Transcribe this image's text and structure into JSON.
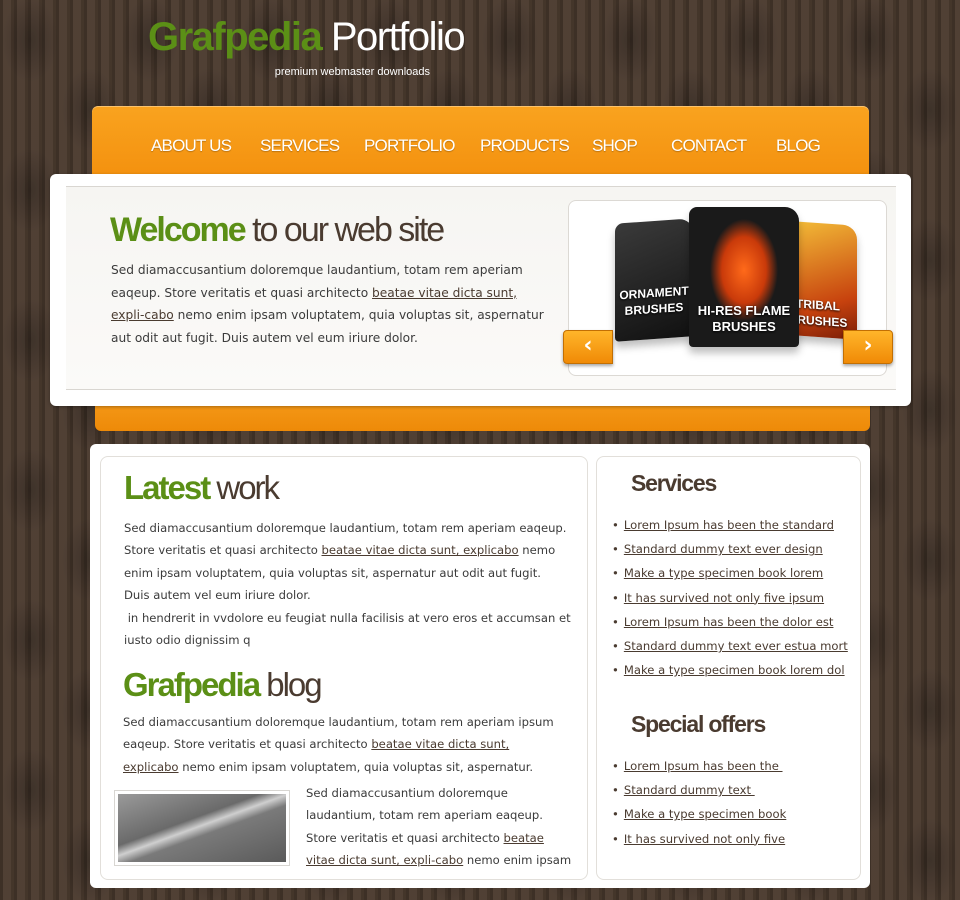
{
  "header": {
    "brand_green": "Grafpedia",
    "brand_white": "Portfolio",
    "tagline": "premium webmaster downloads"
  },
  "nav": {
    "items": [
      "ABOUT US",
      "SERVICES",
      "PORTFOLIO",
      "PRODUCTS",
      "SHOP",
      "CONTACT",
      "BLOG"
    ]
  },
  "welcome": {
    "title_bold": "Welcome",
    "title_rest": " to our web site",
    "text_before": "Sed diamaccusantium doloremque laudantium, totam rem aperiam eaqeup. Store veritatis et quasi architecto ",
    "link": "beatae vitae dicta sunt, expli-cabo",
    "text_after": " nemo enim ipsam voluptatem, quia voluptas sit, aspernatur aut odit aut fugit. Duis autem vel eum iriure dolor."
  },
  "slider": {
    "left_box": "ORNAMENT BRUSHES",
    "middle_box": "HI-RES FLAME BRUSHES",
    "right_box": "TRIBAL BRUSHES",
    "prev_icon": "chevron-left-icon",
    "next_icon": "chevron-right-icon"
  },
  "latest": {
    "title_bold": "Latest",
    "title_rest": " work",
    "p1_before": "Sed diamaccusantium doloremque laudantium, totam rem aperiam eaqeup. Store veritatis et quasi architecto ",
    "p1_link": "beatae vitae dicta sunt, explicabo",
    "p1_after": " nemo enim ipsam voluptatem, quia voluptas sit, aspernatur aut odit aut fugit.",
    "p2": "Duis autem vel eum iriure dolor.",
    "p3": " in hendrerit in vvdolore eu feugiat nulla facilisis at vero eros et accumsan et iusto odio dignissim q"
  },
  "blog": {
    "title_bold": "Grafpedia",
    "title_rest": " blog",
    "p1_before": "Sed diamaccusantium doloremque laudantium, totam rem aperiam ipsum eaqeup. Store veritatis et quasi architecto ",
    "p1_link": "beatae vitae dicta sunt, explicabo",
    "p1_after": " nemo enim ipsam voluptatem, quia voluptas sit, aspernatur.",
    "p2_before": "Sed diamaccusantium doloremque laudantium, totam rem aperiam eaqeup. Store veritatis et quasi architecto ",
    "p2_link": "beatae vitae dicta sunt, expli-cabo",
    "p2_after": " nemo enim ipsam"
  },
  "services": {
    "title": "Services",
    "items": [
      "Lorem Ipsum has been the standard",
      "Standard dummy text ever design",
      "Make a type specimen book lorem",
      "It has survived not only five ipsum",
      "Lorem Ipsum has been the dolor est",
      "Standard dummy text ever estua mort",
      "Make a type specimen book lorem dol"
    ]
  },
  "offers": {
    "title": "Special offers",
    "items": [
      "Lorem Ipsum has been the ",
      "Standard dummy text ",
      "Make a type specimen book",
      "It has survived not only five"
    ]
  },
  "colors": {
    "accent_orange": "#f59a14",
    "brand_green": "#5b8f16",
    "text_brown": "#4a3b30",
    "background": "#4a3a2e"
  }
}
